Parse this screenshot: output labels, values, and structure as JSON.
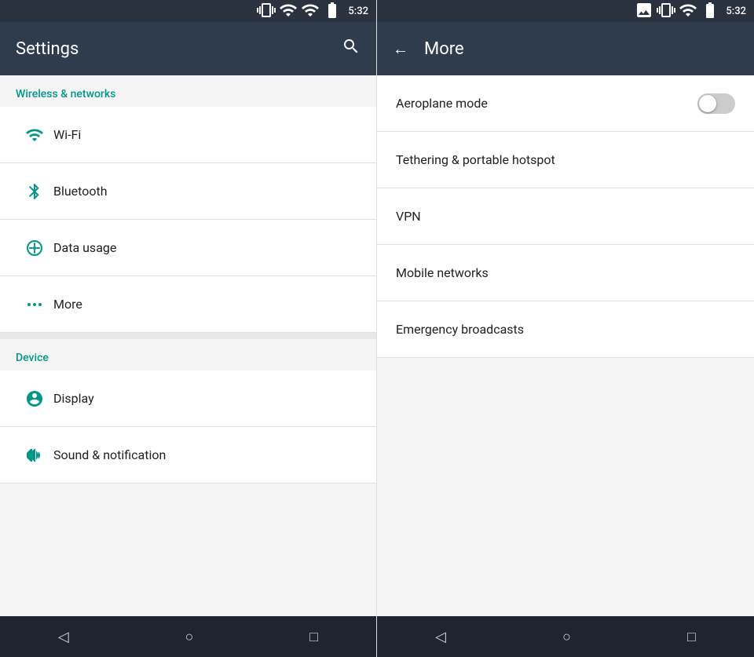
{
  "left_panel": {
    "status_bar": {
      "time": "5:32",
      "icons": "vibrate signal wifi battery"
    },
    "header": {
      "title": "Settings",
      "search_icon": "search"
    },
    "sections": [
      {
        "id": "wireless",
        "label": "Wireless & networks",
        "items": [
          {
            "id": "wifi",
            "icon": "wifi",
            "label": "Wi-Fi"
          },
          {
            "id": "bluetooth",
            "icon": "bluetooth",
            "label": "Bluetooth"
          },
          {
            "id": "data-usage",
            "icon": "data",
            "label": "Data usage"
          },
          {
            "id": "more",
            "icon": "more",
            "label": "More"
          }
        ]
      },
      {
        "id": "device",
        "label": "Device",
        "items": [
          {
            "id": "display",
            "icon": "display",
            "label": "Display"
          },
          {
            "id": "sound",
            "icon": "sound",
            "label": "Sound & notification"
          }
        ]
      }
    ],
    "nav_bar": {
      "back": "◁",
      "home": "○",
      "recents": "□"
    }
  },
  "right_panel": {
    "status_bar": {
      "time": "5:32"
    },
    "header": {
      "back_icon": "←",
      "title": "More"
    },
    "items": [
      {
        "id": "aeroplane",
        "label": "Aeroplane mode",
        "has_toggle": true,
        "toggle_on": false
      },
      {
        "id": "tethering",
        "label": "Tethering & portable hotspot",
        "has_toggle": false
      },
      {
        "id": "vpn",
        "label": "VPN",
        "has_toggle": false
      },
      {
        "id": "mobile-networks",
        "label": "Mobile networks",
        "has_toggle": false
      },
      {
        "id": "emergency",
        "label": "Emergency broadcasts",
        "has_toggle": false
      }
    ],
    "nav_bar": {
      "back": "◁",
      "home": "○",
      "recents": "□"
    }
  }
}
